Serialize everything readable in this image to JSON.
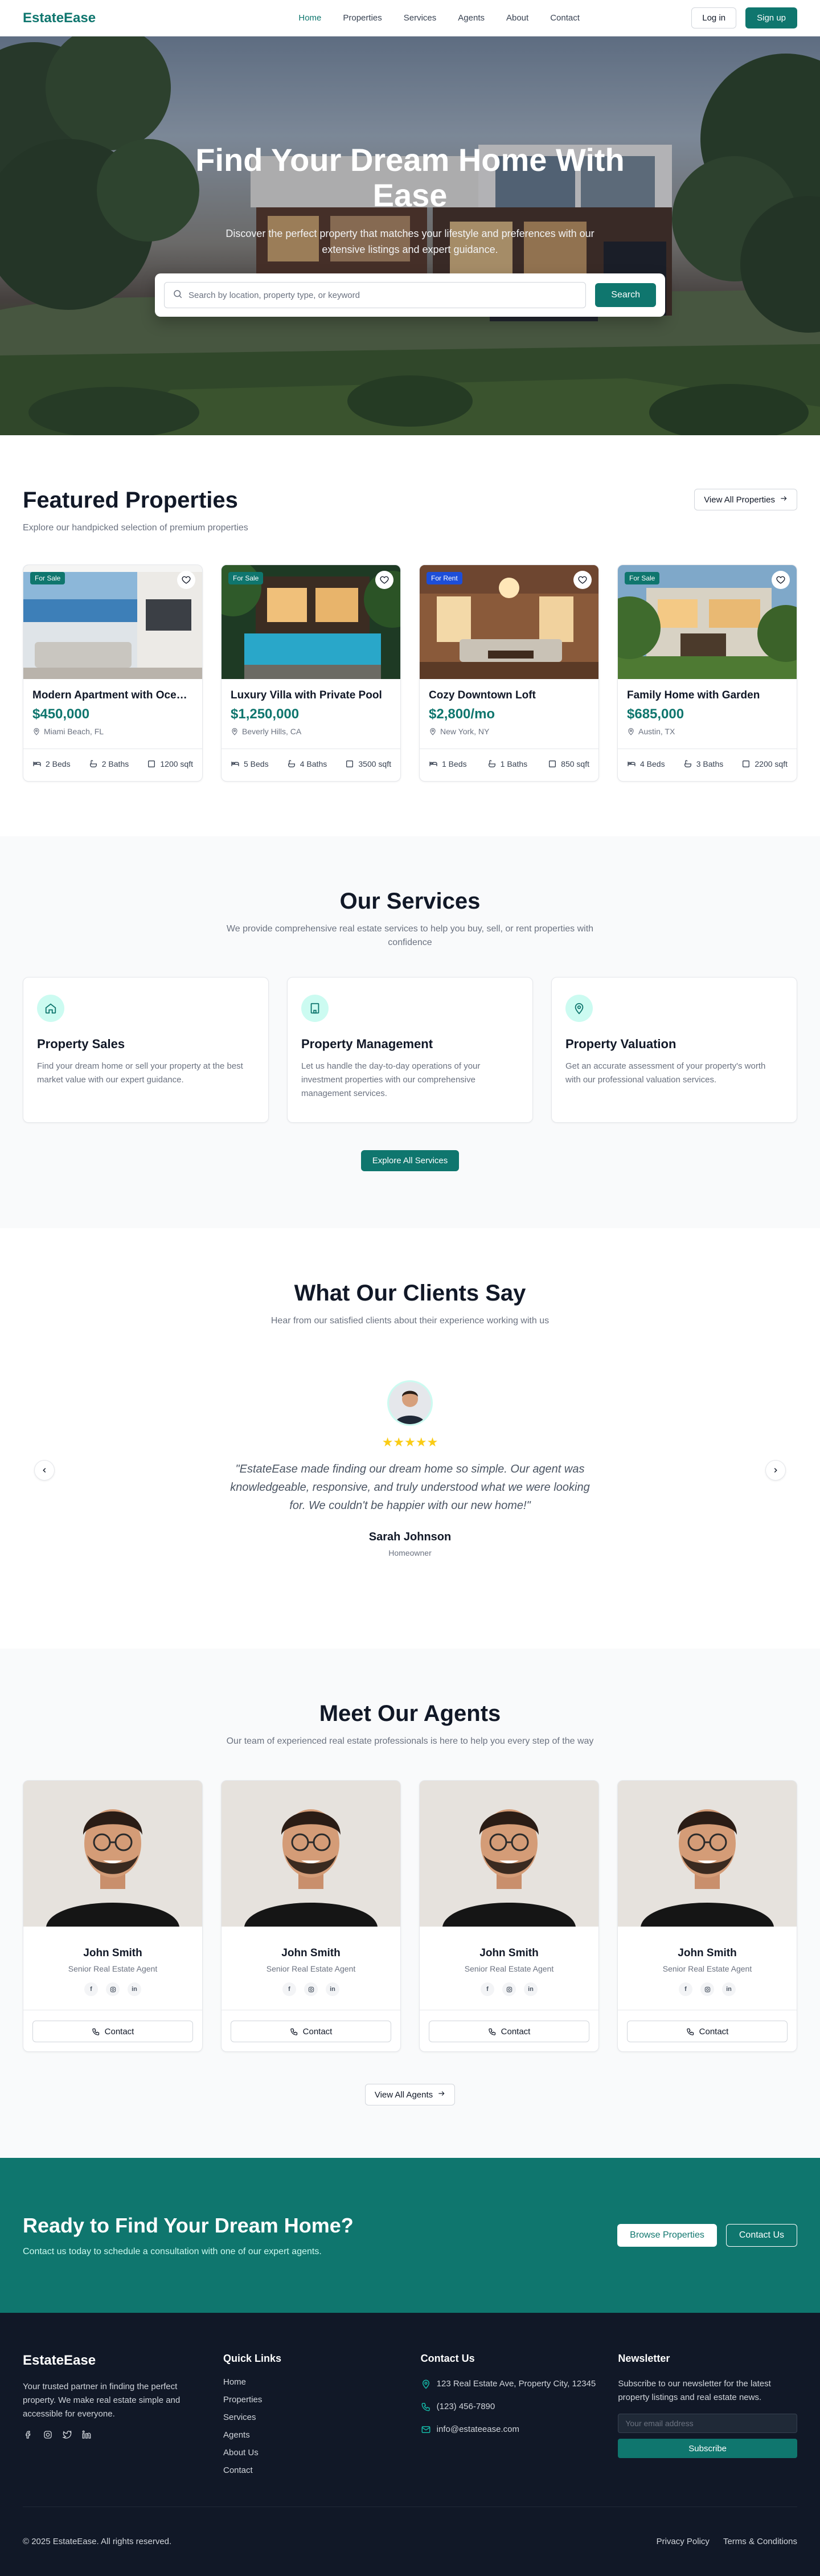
{
  "brand": {
    "name": "EstateEase",
    "accent": "#0f766e",
    "dark": "#111827"
  },
  "nav": {
    "links": [
      "Home",
      "Properties",
      "Services",
      "Agents",
      "About",
      "Contact"
    ],
    "active": "Home",
    "login": "Log in",
    "signup": "Sign up"
  },
  "hero": {
    "title": "Find Your Dream Home With Ease",
    "subtitle": "Discover the perfect property that matches your lifestyle and preferences with our extensive listings and expert guidance.",
    "search_placeholder": "Search by location, property type, or keyword",
    "search_button": "Search"
  },
  "featured": {
    "title": "Featured Properties",
    "subtitle": "Explore our handpicked selection of premium properties",
    "view_all": "View All Properties",
    "items": [
      {
        "badge": "For Sale",
        "badge_color": "#0f766e",
        "title": "Modern Apartment with Ocean View",
        "price": "$450,000",
        "location": "Miami Beach, FL",
        "beds": "2 Beds",
        "baths": "2 Baths",
        "sqft": "1200 sqft"
      },
      {
        "badge": "For Sale",
        "badge_color": "#0f766e",
        "title": "Luxury Villa with Private Pool",
        "price": "$1,250,000",
        "location": "Beverly Hills, CA",
        "beds": "5 Beds",
        "baths": "4 Baths",
        "sqft": "3500 sqft"
      },
      {
        "badge": "For Rent",
        "badge_color": "#1d4ed8",
        "title": "Cozy Downtown Loft",
        "price": "$2,800/mo",
        "location": "New York, NY",
        "beds": "1 Beds",
        "baths": "1 Baths",
        "sqft": "850 sqft"
      },
      {
        "badge": "For Sale",
        "badge_color": "#0f766e",
        "title": "Family Home with Garden",
        "price": "$685,000",
        "location": "Austin, TX",
        "beds": "4 Beds",
        "baths": "3 Baths",
        "sqft": "2200 sqft"
      }
    ]
  },
  "services": {
    "title": "Our Services",
    "subtitle": "We provide comprehensive real estate services to help you buy, sell, or rent properties with confidence",
    "items": [
      {
        "icon": "home-icon",
        "title": "Property Sales",
        "desc": "Find your dream home or sell your property at the best market value with our expert guidance."
      },
      {
        "icon": "building-icon",
        "title": "Property Management",
        "desc": "Let us handle the day-to-day operations of your investment properties with our comprehensive management services."
      },
      {
        "icon": "map-pin-icon",
        "title": "Property Valuation",
        "desc": "Get an accurate assessment of your property's worth with our professional valuation services."
      }
    ],
    "button": "Explore All Services"
  },
  "testimonials": {
    "title": "What Our Clients Say",
    "subtitle": "Hear from our satisfied clients about their experience working with us",
    "rating": 5,
    "stars": "★★★★★",
    "quote": "\"EstateEase made finding our dream home so simple. Our agent was knowledgeable, responsive, and truly understood what we were looking for. We couldn't be happier with our new home!\"",
    "name": "Sarah Johnson",
    "role": "Homeowner"
  },
  "agents": {
    "title": "Meet Our Agents",
    "subtitle": "Our team of experienced real estate professionals is here to help you every step of the way",
    "items": [
      {
        "name": "John Smith",
        "role": "Senior Real Estate Agent"
      },
      {
        "name": "John Smith",
        "role": "Senior Real Estate Agent"
      },
      {
        "name": "John Smith",
        "role": "Senior Real Estate Agent"
      },
      {
        "name": "John Smith",
        "role": "Senior Real Estate Agent"
      }
    ],
    "contact_label": "Contact",
    "view_all": "View All Agents"
  },
  "cta": {
    "title": "Ready to Find Your Dream Home?",
    "subtitle": "Contact us today to schedule a consultation with one of our expert agents.",
    "primary": "Browse Properties",
    "secondary": "Contact Us"
  },
  "footer": {
    "brand": "EstateEase",
    "description": "Your trusted partner in finding the perfect property. We make real estate simple and accessible for everyone.",
    "quick_links_title": "Quick Links",
    "quick_links": [
      "Home",
      "Properties",
      "Services",
      "Agents",
      "About Us",
      "Contact"
    ],
    "contact_title": "Contact Us",
    "address": "123 Real Estate Ave, Property City, 12345",
    "phone": "(123) 456-7890",
    "email": "info@estateease.com",
    "newsletter_title": "Newsletter",
    "newsletter_text": "Subscribe to our newsletter for the latest property listings and real estate news.",
    "newsletter_placeholder": "Your email address",
    "subscribe": "Subscribe",
    "copyright": "© 2025 EstateEase. All rights reserved.",
    "privacy": "Privacy Policy",
    "terms": "Terms & Conditions"
  }
}
